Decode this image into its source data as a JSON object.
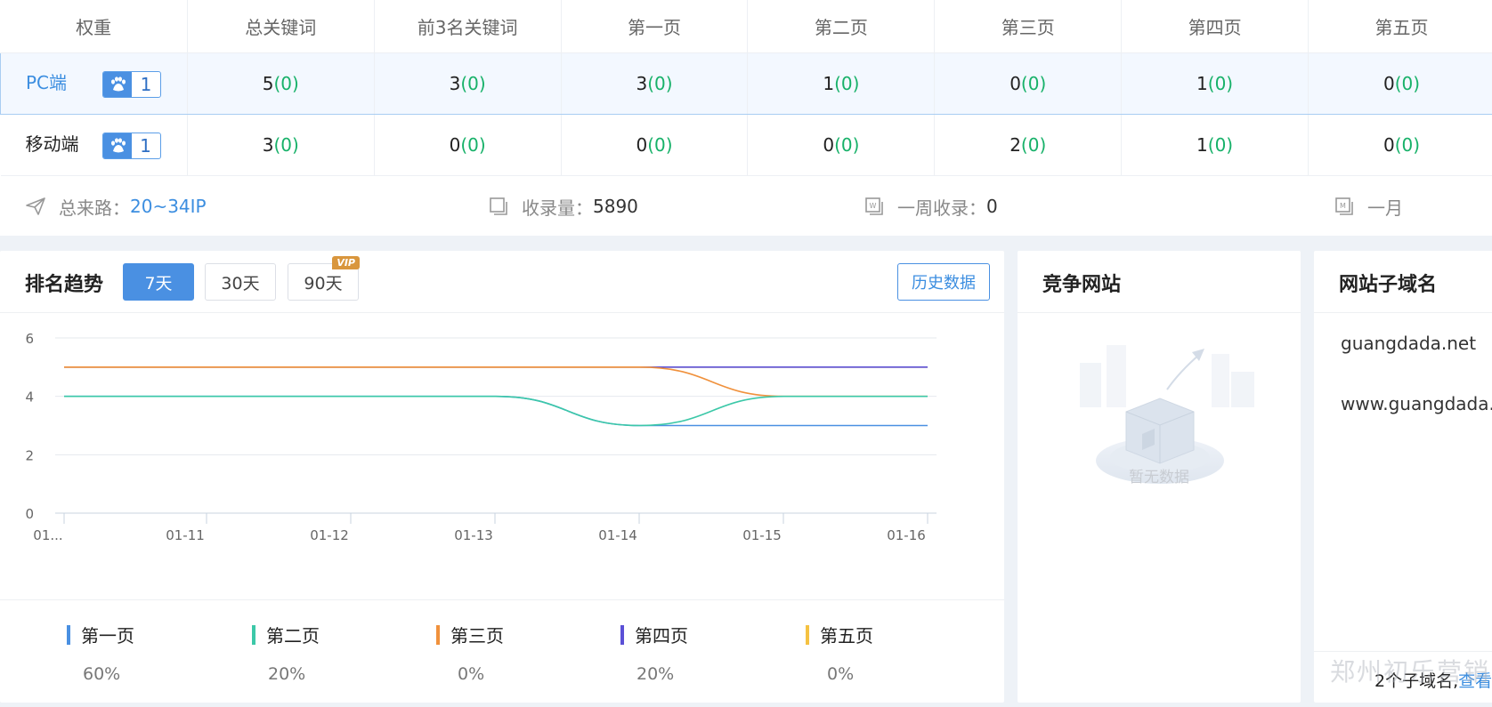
{
  "table": {
    "headers": [
      "权重",
      "总关键词",
      "前3名关键词",
      "第一页",
      "第二页",
      "第三页",
      "第四页",
      "第五页"
    ],
    "rows": [
      {
        "label": "PC端",
        "badge": "1",
        "cells": [
          [
            "5",
            "(0)"
          ],
          [
            "3",
            "(0)"
          ],
          [
            "3",
            "(0)"
          ],
          [
            "1",
            "(0)"
          ],
          [
            "0",
            "(0)"
          ],
          [
            "1",
            "(0)"
          ],
          [
            "0",
            "(0)"
          ]
        ]
      },
      {
        "label": "移动端",
        "badge": "1",
        "cells": [
          [
            "3",
            "(0)"
          ],
          [
            "0",
            "(0)"
          ],
          [
            "0",
            "(0)"
          ],
          [
            "0",
            "(0)"
          ],
          [
            "2",
            "(0)"
          ],
          [
            "1",
            "(0)"
          ],
          [
            "0",
            "(0)"
          ]
        ]
      }
    ]
  },
  "stats": {
    "traffic_label": "总来路：",
    "traffic_value": "20~34IP",
    "index_label": "收录量：",
    "index_value": "5890",
    "week_label": "一周收录：",
    "week_value": "0",
    "month_label": "一月"
  },
  "trend": {
    "title": "排名趋势",
    "ranges": [
      "7天",
      "30天",
      "90天"
    ],
    "vip": "VIP",
    "history": "历史数据"
  },
  "chart_data": {
    "type": "line",
    "x": [
      "01...",
      "01-11",
      "01-12",
      "01-13",
      "01-14",
      "01-15",
      "01-16"
    ],
    "ylim": [
      0,
      6
    ],
    "yticks": [
      0,
      2,
      4,
      6
    ],
    "series": [
      {
        "name": "第一页",
        "color": "#4a90e2",
        "values": [
          4,
          4,
          4,
          4,
          3,
          3,
          3
        ]
      },
      {
        "name": "第二页",
        "color": "#3cc8a8",
        "values": [
          4,
          4,
          4,
          4,
          3,
          4,
          4
        ]
      },
      {
        "name": "第三页",
        "color": "#f0913c",
        "values": [
          5,
          5,
          5,
          5,
          5,
          4,
          4
        ]
      },
      {
        "name": "第四页",
        "color": "#5b50d6",
        "values": [
          5,
          5,
          5,
          5,
          5,
          5,
          5
        ]
      },
      {
        "name": "第五页",
        "color": "#f5c242",
        "values": [
          5,
          5,
          5,
          5,
          5,
          5,
          5
        ]
      }
    ],
    "legend": [
      {
        "name": "第一页",
        "color": "#4a90e2",
        "pct": "60%"
      },
      {
        "name": "第二页",
        "color": "#3cc8a8",
        "pct": "20%"
      },
      {
        "name": "第三页",
        "color": "#f0913c",
        "pct": "0%"
      },
      {
        "name": "第四页",
        "color": "#5b50d6",
        "pct": "20%"
      },
      {
        "name": "第五页",
        "color": "#f5c242",
        "pct": "0%"
      }
    ],
    "grid": true
  },
  "competitor": {
    "title": "竞争网站",
    "empty": "暂无数据"
  },
  "subdomain": {
    "title": "网站子域名",
    "items": [
      "guangdada.net",
      "www.guangdada.net"
    ],
    "count": "2个子域名,",
    "link": "查看"
  },
  "watermark": "郑州初乐营销"
}
